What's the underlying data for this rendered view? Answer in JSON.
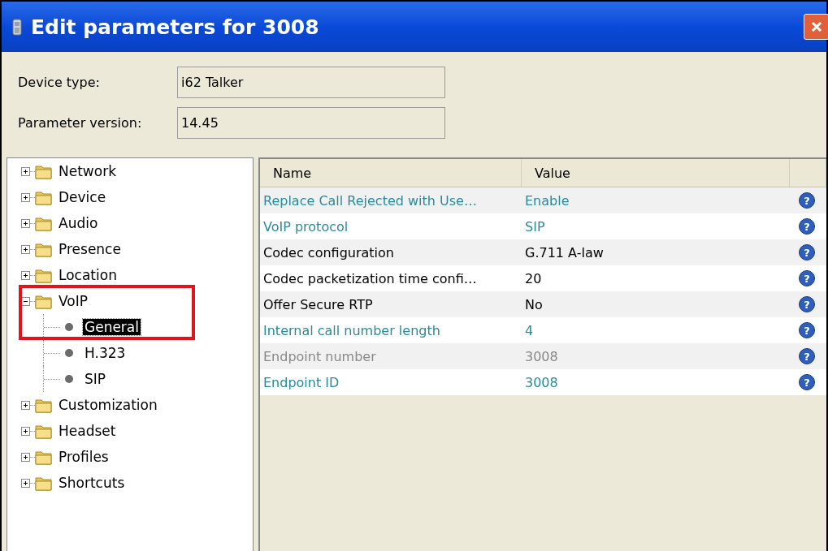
{
  "window": {
    "title": "Edit parameters for 3008"
  },
  "fields": [
    {
      "label": "Device type:",
      "value": "i62 Talker"
    },
    {
      "label": "Parameter version:",
      "value": "14.45"
    }
  ],
  "tree": [
    {
      "label": "Network",
      "expanded": false,
      "selected": false
    },
    {
      "label": "Device",
      "expanded": false,
      "selected": false
    },
    {
      "label": "Audio",
      "expanded": false,
      "selected": false
    },
    {
      "label": "Presence",
      "expanded": false,
      "selected": false
    },
    {
      "label": "Location",
      "expanded": false,
      "selected": false
    },
    {
      "label": "VoIP",
      "expanded": true,
      "selected": false,
      "children": [
        {
          "label": "General",
          "selected": true
        },
        {
          "label": "H.323",
          "selected": false
        },
        {
          "label": "SIP",
          "selected": false
        }
      ]
    },
    {
      "label": "Customization",
      "expanded": false,
      "selected": false
    },
    {
      "label": "Headset",
      "expanded": false,
      "selected": false
    },
    {
      "label": "Profiles",
      "expanded": false,
      "selected": false
    },
    {
      "label": "Shortcuts",
      "expanded": false,
      "selected": false
    }
  ],
  "table": {
    "columns": [
      "Name",
      "Value"
    ],
    "rows": [
      {
        "name": "Replace Call Rejected with Use…",
        "value": "Enable",
        "kind": "changed",
        "help": "?"
      },
      {
        "name": "VoIP protocol",
        "value": "SIP",
        "kind": "changed",
        "help": "?"
      },
      {
        "name": "Codec configuration",
        "value": "G.711 A-law",
        "kind": "default",
        "help": "?"
      },
      {
        "name": "Codec packetization time confi…",
        "value": "20",
        "kind": "default",
        "help": "?"
      },
      {
        "name": "Offer Secure RTP",
        "value": "No",
        "kind": "default",
        "help": "?"
      },
      {
        "name": "Internal call number length",
        "value": "4",
        "kind": "changed",
        "help": "?"
      },
      {
        "name": "Endpoint number",
        "value": "3008",
        "kind": "readonly",
        "help": "?"
      },
      {
        "name": "Endpoint ID",
        "value": "3008",
        "kind": "changed",
        "help": "?"
      }
    ]
  }
}
